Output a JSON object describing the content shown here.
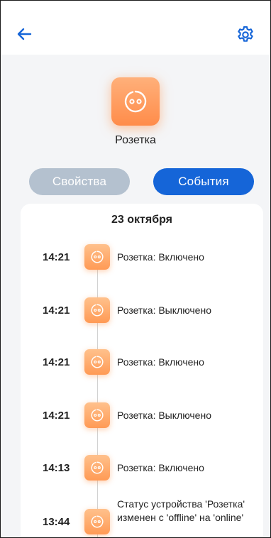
{
  "header": {
    "back_icon": "arrow-left-icon",
    "settings_icon": "gear-icon",
    "accent_color": "#1565d8"
  },
  "device": {
    "name": "Розетка",
    "icon": "power-socket-icon",
    "icon_color": "#ff9a55"
  },
  "tabs": [
    {
      "label": "Свойства",
      "active": false
    },
    {
      "label": "События",
      "active": true
    }
  ],
  "events": {
    "date": "23 октября",
    "items": [
      {
        "time": "14:21",
        "text": "Розетка: Включено"
      },
      {
        "time": "14:21",
        "text": "Розетка: Выключено"
      },
      {
        "time": "14:21",
        "text": "Розетка: Включено"
      },
      {
        "time": "14:21",
        "text": "Розетка: Выключено"
      },
      {
        "time": "14:13",
        "text": "Розетка: Включено"
      },
      {
        "time": "13:44",
        "text": "Статус устройства 'Розетка' изменен с 'offline' на 'online'"
      }
    ]
  }
}
